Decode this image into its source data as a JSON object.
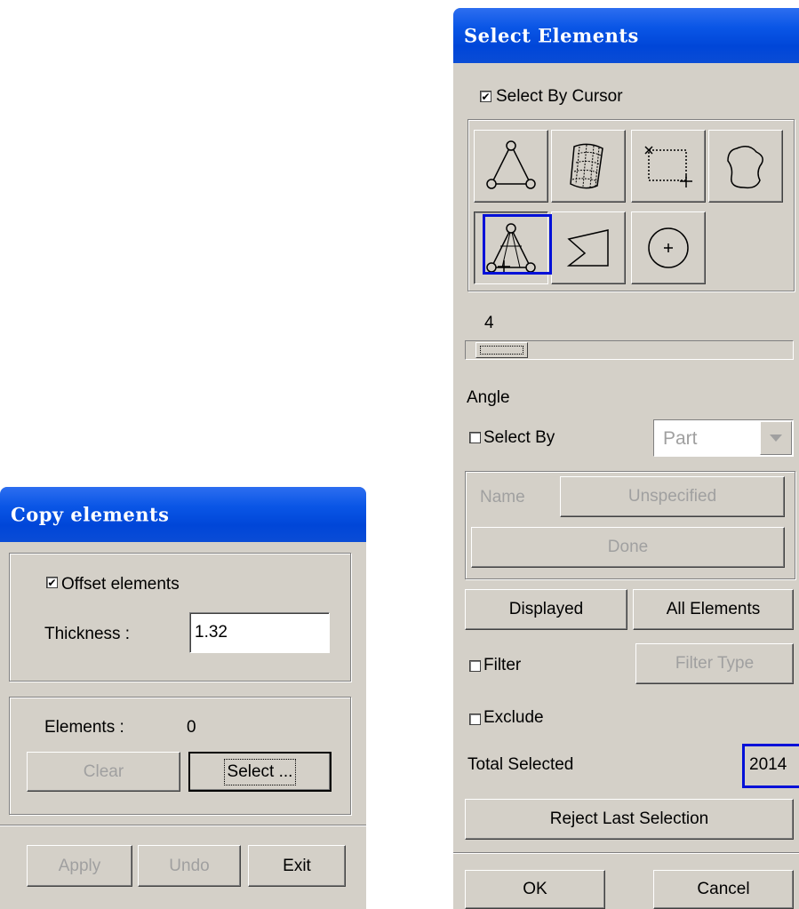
{
  "copy_window": {
    "title": "Copy elements",
    "offset_label": "Offset elements",
    "offset_checked": true,
    "thickness_label": "Thickness :",
    "thickness_value": "1.32",
    "elements_label": "Elements :",
    "elements_count": "0",
    "clear_label": "Clear",
    "select_label": "Select ...",
    "apply_label": "Apply",
    "undo_label": "Undo",
    "exit_label": "Exit"
  },
  "select_window": {
    "title": "Select Elements",
    "select_by_cursor_label": "Select By Cursor",
    "select_by_cursor_checked": true,
    "tools": [
      {
        "icon": "triangle-node-icon"
      },
      {
        "icon": "surface-mesh-icon"
      },
      {
        "icon": "box-select-icon"
      },
      {
        "icon": "freehand-lasso-icon"
      },
      {
        "icon": "spread-select-icon",
        "pressed": true
      },
      {
        "icon": "polygon-select-icon"
      },
      {
        "icon": "circle-select-icon"
      }
    ],
    "slider_value": "4",
    "angle_label": "Angle",
    "select_by_label": "Select By",
    "select_by_checked": false,
    "select_by_option": "Part",
    "name_label": "Name",
    "name_value": "Unspecified",
    "done_label": "Done",
    "displayed_label": "Displayed",
    "all_elements_label": "All Elements",
    "filter_label": "Filter",
    "filter_checked": false,
    "filter_type_label": "Filter Type",
    "exclude_label": "Exclude",
    "exclude_checked": false,
    "total_selected_label": "Total Selected",
    "total_selected_value": "2014",
    "reject_label": "Reject Last Selection",
    "ok_label": "OK",
    "cancel_label": "Cancel"
  },
  "colors": {
    "titlebar": "#0046d8",
    "panel": "#d4d0c8",
    "highlight": "#0010d8"
  }
}
